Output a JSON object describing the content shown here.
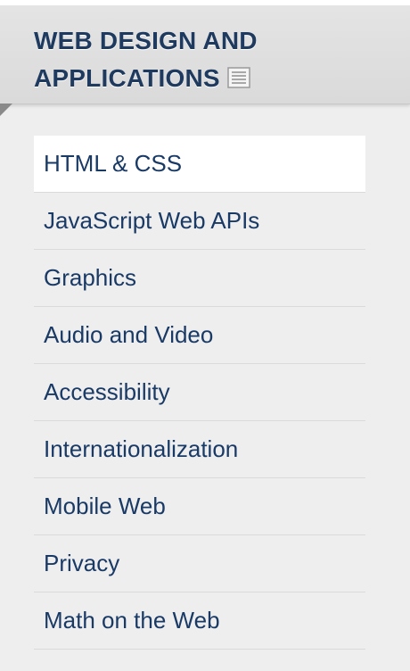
{
  "section": {
    "title_line1": "WEB DESIGN AND",
    "title_line2": "APPLICATIONS",
    "title_icon": "document-icon"
  },
  "menu": {
    "items": [
      {
        "label": "HTML & CSS",
        "active": true
      },
      {
        "label": "JavaScript Web APIs",
        "active": false
      },
      {
        "label": "Graphics",
        "active": false
      },
      {
        "label": "Audio and Video",
        "active": false
      },
      {
        "label": "Accessibility",
        "active": false
      },
      {
        "label": "Internationalization",
        "active": false
      },
      {
        "label": "Mobile Web",
        "active": false
      },
      {
        "label": "Privacy",
        "active": false
      },
      {
        "label": "Math on the Web",
        "active": false
      }
    ]
  },
  "colors": {
    "heading": "#1f3a5f",
    "link": "#1a3a66",
    "panel_bg": "#eeeeee",
    "active_bg": "#ffffff"
  }
}
